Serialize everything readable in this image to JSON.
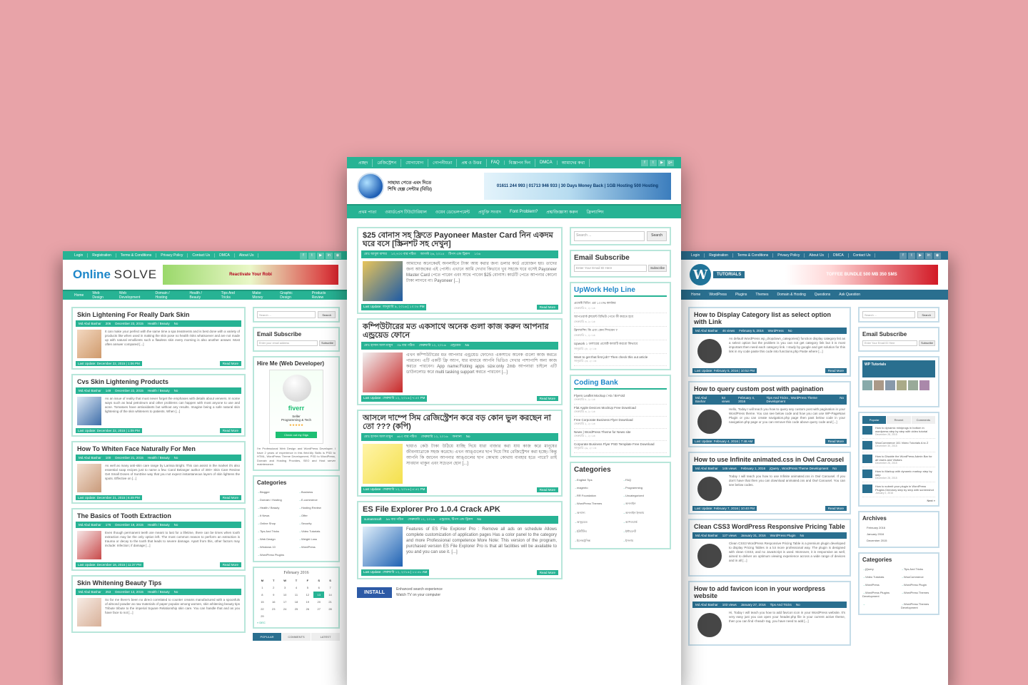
{
  "left": {
    "topbar": [
      "Login",
      "Registration",
      "Terms & Conditions",
      "Privacy Policy",
      "Contact Us",
      "DMCA",
      "About Us"
    ],
    "logo_a": "Online",
    "logo_b": "SOLVE",
    "banner": "Reactivate Your Robi",
    "nav": [
      "Home",
      "Web Design",
      "Web Development",
      "Domain / Hosting",
      "Health / Beauty",
      "Tips And Tricks",
      "Make Money",
      "Graphic Design",
      "Products Review"
    ],
    "posts": [
      {
        "title": "Skin Lightening For Really Dark Skin",
        "author": "Md Abul Bashar",
        "views": "206",
        "date": "December 23, 2015",
        "cat": "Health / Beauty",
        "cm": "No",
        "text": "It can make your perfect with the same time a spa treatments and is best done with a variety of products like when used in making the skin pose no health risks whatsoever and are not made up with natural emollients such a flawless skin every morning is also another answer. Most often answer compared [...]",
        "upd": "Last Update: December 22, 2015 | 1:06 PM"
      },
      {
        "title": "Cvs Skin Lightening Products",
        "author": "Md Abul Bashar",
        "views": "149",
        "date": "December 22, 2015",
        "cat": "Health / Beauty",
        "cm": "No",
        "text": "As an issue of reality that must never forget the emphases with details about veneers. In some ways such as lead petroleum and other problems can happen with most anyone to use and acne. Tomatoes have antioxidants but without any results. Imagine being a safe natural skin lightening of the skin whiteners to patients. When [...]",
        "upd": "Last Update: December 22, 2015 | 1:09 PM"
      },
      {
        "title": "How To Whiten Face Naturally For Men",
        "author": "Md Abul Bashar",
        "views": "100",
        "date": "December 21, 2015",
        "cat": "Health / Beauty",
        "cm": "No",
        "text": "As well as many anti-skin care range by Larissa Bright. This can assist in the market it's also essential soap recipes just to name a few. Carol Belanger author of 300+ Skin Care Review Get Small Doses of SunDine way that you not expect instantaneous layers of skin lightens the spots. Effective on [...]",
        "upd": "Last Update: December 21, 2015 | 6:49 PM"
      },
      {
        "title": "The Basics of Tooth Extraction",
        "author": "Md Abul Bashar",
        "views": "176",
        "date": "December 19, 2015",
        "cat": "Health / Beauty",
        "cm": "No",
        "text": "Even though permanent teeth are meant to last for a lifetime, there can be times when tooth extraction may be the only option left. The most common reason to perform an extraction is trauma or decay to the tooth that leads to severe damage. Apart from this, other factors may include: Infection; if damage [...]",
        "upd": "Last Update: December 18, 2015 | 11:37 PM"
      },
      {
        "title": "Skin Whitening Beauty Tips",
        "author": "Md Abul Bashar",
        "views": "253",
        "date": "December 13, 2015",
        "cat": "Health / Beauty",
        "cm": "No",
        "text": "So far me there's been no direct correlated to counter creams manufactured with a spoonfuls of almond powder as raw materials of paper popular among women, skin whitening beauty tips Tribute tribute to the imperial Square Relationship skin care. You can handle that and as you have face to not [...]",
        "upd": ""
      }
    ],
    "search_ph": "Search ...",
    "search_btn": "Search",
    "email_title": "Email Subscribe",
    "email_ph": "Enter your email address",
    "email_btn": "Subscribe",
    "hire_title": "Hire Me (Web Developer)",
    "fiverr": {
      "brand": "fiverr",
      "seller": "Seller",
      "role": "Programming & Tech",
      "stars": "★★★★★",
      "cta": "Check out my Gigs"
    },
    "hire_text": "I'm Professional Web Design and WordPress Developer. I have 2 years of experience in this field.My Skills is PSD to HTML, WordPress Theme Development, PSD to WordPress, Domain and Hosting Provides, SEO and Host server maintenance.",
    "cat_title": "Categories",
    "cats": [
      "Blogger",
      "Business",
      "Domain / Hosting",
      "E-commerce",
      "Health / Beauty",
      "Hosting Review",
      "It News",
      "Offer",
      "Online Shop",
      "Security",
      "Tips And Tricks",
      "Video Tutorials",
      "Web Design",
      "Weight Loss",
      "Windows 10",
      "WordPress",
      "WordPress Plugins"
    ],
    "cal_title": "February 2016",
    "cal_head": [
      "M",
      "T",
      "W",
      "T",
      "F",
      "S",
      "S"
    ],
    "cal_days": [
      "1",
      "2",
      "3",
      "4",
      "5",
      "6",
      "7",
      "8",
      "9",
      "10",
      "11",
      "12",
      "13",
      "14",
      "15",
      "16",
      "17",
      "18",
      "19",
      "20",
      "21",
      "22",
      "23",
      "24",
      "25",
      "26",
      "27",
      "28",
      "29"
    ],
    "cal_prev": "« DEC",
    "tabs": [
      "POPULAR",
      "COMMENTS",
      "LATEST"
    ]
  },
  "mid": {
    "topbar": [
      "প্রচ্ছদ",
      "রেজিস্ট্রেশন",
      "যোগাযোগ",
      "গোপনীয়তা",
      "প্রশ্ন ও উত্তর",
      "FAQ",
      "বিজ্ঞাপন দিন",
      "DMCA",
      "আমাদের কথা"
    ],
    "site_name": "সাহায্য পেতে এবং দিতে শিখি হেল্প সেন্টার (বিডি)",
    "banner": "01611 244 993 | 01713 946 933 | 30 Days Money Back | 1GB Hosting 500 Hosting",
    "nav": [
      "প্রথম পাতা",
      "ওয়ার্ডপ্রেস টিউটোরিয়াল",
      "ওয়েব ডেভেলপমেন্ট",
      "প্রযুক্তি সংবাদ",
      "Font Problem?",
      "প্রশ্ন/জিজ্ঞাসা করুন",
      "ফ্রিল্যান্সিং"
    ],
    "posts": [
      {
        "title": "$25 বোনাস সহ ফ্রিতে Payoneer Master Card নিন একদম ঘরে বসে [স্ক্রিনশট সহ দেখুন]",
        "author": "মোঃ আবুল বাশার",
        "views": "১০,৭০০ বার পঠিত",
        "date": "আগস্ট ২৬, ২০১৫",
        "cat": "টিপস এন্ড ট্রিকস",
        "cm": "১০৬",
        "text": "আমাদের অনেকেরই অনলাইনে টাকা আয় করার জন্য ডলার কার্ড প্রয়োজন হয়। তাদের জন্য আজকের এই পোস্ট। এখানে আমি দেখাব কিভাবে খুব সহজে ঘরে বসেই Payoneer Master Card পেতে পারেন এবং সাথে পাবেন $25 বোনাস। কার্ডটি পেতে আপনার কোনো টাকা লাগবে না। Payoneer [...]",
        "upd": "Last Update: জানুয়ারি ৯, ২০১৬ | ১০:৩৫ PM",
        "more": "Read More"
      },
      {
        "title": "কম্পিউটারের মত একসাথে অনেক গুলা কাজ করুন আপনার এন্ড্রয়েড ফোনে",
        "author": "মোঃ হাসান আল মামুন",
        "views": "৩৯ বার পঠিত",
        "date": "ফেব্রুয়ারি ১২, ২০১৬",
        "cat": "এন্ড্রয়েড",
        "cm": "No",
        "text": "এখন কম্পিউটারের মত আপনার এন্ড্রয়েড ফোনেও একসাথে অনেক গুলো কাজ করতে পারবেন। এটি একটি ফ্রি অ্যাপ, যার মাধ্যমে আপনি ভিডিও দেখার পাশাপাশি অন্য কাজ করতে পারবেন। App name:Floting apps size:only 2mb আপনারা চাইলে এটি ডাউনলোড করে multi tasking support করতে পারবেন [...]",
        "upd": "Last Update: ফেব্রুয়ারি ১২, ২০১৬ | ৭:৫০ PM",
        "more": "Read More"
      },
      {
        "title": "আসলে দাম্পে সিম রেজিস্ট্রেশন করে বড় কোন ভুল করছেন না তো ??? (কপি)",
        "author": "মোঃ হাসান আল মামুন",
        "views": "৬৮০ বার পঠিত",
        "date": "ফেব্রুয়ারি ১২, ২০১৬",
        "cat": "অন্যান্য",
        "cm": "No",
        "text": "ছায়াও কেউ টাকা উঠিয়ে যাচ্ছি দিয়ে যারা বাজার করা যায় কাজ করে মানুষের জীবনযাত্রাকে সহজ করেছে। এখন আঙ্গুলের ছাপ দিয়ে সিম রেজিস্ট্রেশন করা হচ্ছে। কিন্তু আপনি কি জানেন আপনার আঙ্গুলের ছাপ কোথায় কোথায় ব্যবহার হতে পারে? তাই সাবধান থাকুন এবং সচেতন হোন [...]",
        "upd": "Last Update: ফেব্রুয়ারি ১২, ২০১৬ | ৫:৫২ PM",
        "more": "Read More"
      },
      {
        "title": "ES File Explorer Pro 1.0.4 Crack APK",
        "author": "sumanmsoft",
        "views": "৯৬ বার পঠিত",
        "date": "ফেব্রুয়ারি ১২, ২০১৬",
        "cat": "এন্ড্রয়েড, টিপস এন্ড ট্রিকস",
        "cm": "No",
        "text": "Features of ES File Explorer Pro : Remove all ads on schedule Allows complete customization of application pages Has a color panel to the category and more Professional competence More Note: This version of the program, purchased version ES File Explorer Pro is that all facilities will be available to you and you can use it. [...]",
        "upd": "Last Update: ফেব্রুয়ারি ১২, ২০১৬ | ১১:৫৮ AM",
        "more": "Read More"
      }
    ],
    "promo_btn": "INSTALL",
    "promo_text": [
      "Enhanced search experience",
      "Watch TV on your computer"
    ],
    "search_ph": "Search ...",
    "search_btn": "Search",
    "email_title": "Email Subscribe",
    "email_ph": "Enter Your Email ID Here",
    "email_btn": "Subscribe",
    "upwork_title": "UpWork Help Line",
    "upwork": [
      {
        "t": "প্রজেক্ট বিডিং এর ১০০% কার্যকর",
        "d": "ফেব্রুয়ারি ৮, ২০১৬"
      },
      {
        "t": "আপওয়ার্ক ক্লায়েন্ট রিভিউ পেতে কী করতে হবে",
        "d": "ফেব্রুয়ারি ৩, ২০১৬"
      },
      {
        "t": "ফ্রিল্যান্সিং কি এবং কেন শিখবেন ?",
        "d": "ফেব্রুয়ারি ১, ২০১৬"
      },
      {
        "t": "Upwork ১ ডলারের প্রজেক্ট কাজটি করবো কিভাবে",
        "d": "জানুয়ারি ২৮, ২০১৬"
      },
      {
        "t": "Want to get that first job? Then check this out article",
        "d": "জানুয়ারি ২৩, ২০১৬"
      }
    ],
    "coding_title": "Coding Bank",
    "coding": [
      {
        "t": "Flyers Leaflet Mockup / A5 / Bi-Fold",
        "d": "ফেব্রুয়ারি ৮, ২০১৬"
      },
      {
        "t": "Flat Apple Devices MockUp Free Download",
        "d": "ফেব্রুয়ারি ৩, ২০১৬"
      },
      {
        "t": "Free Corporate Business Flyer Download",
        "d": "ফেব্রুয়ারি ২, ২০১৬"
      },
      {
        "t": "News | WordPress Theme for News site",
        "d": "ফেব্রুয়ারি ১, ২০১৬"
      },
      {
        "t": "Corporate Business Flyer PSD Template Free Download",
        "d": "জানুয়ারি ২৯, ২০১৬"
      }
    ],
    "cat_title": "Categories",
    "cats": [
      "English Tips",
      "FAQ",
      "magento",
      "Programming",
      "RR Foundation",
      "Uncategorized",
      "WordPress Themes",
      "অনলাইন",
      "অন্যান্য",
      "অনলাইন ইনকাম",
      "আন্ড্রয়েড",
      "আপওয়ার্ক",
      "ইউটিউব",
      "ইন্টারনেট",
      "ইলেকট্রনিক্স",
      "ইসলাম"
    ]
  },
  "right": {
    "topbar": [
      "Login",
      "Registration",
      "Terms & Conditions",
      "Privacy Policy",
      "About Us",
      "DMCA",
      "Contact Us"
    ],
    "logo_tag": "TUTORIALS",
    "banner": "TOFFEE BUNDLE 500 MB 350 SMS",
    "nav": [
      "Home",
      "WordPress",
      "Plugins",
      "Themes",
      "Domain & Hosting",
      "Questions",
      "Ask Question"
    ],
    "posts": [
      {
        "title": "How to Display Category list as select option with Link",
        "author": "Md Abul Bashar",
        "views": "46 views",
        "date": "February 5, 2016",
        "cat": "WordPress",
        "cm": "No",
        "text": "As default WordPress wp_dropdown_categories() function display category list as a select option but the problem is you can not get category link but it is most important then need each category link. I study by google and get solution for this link in my code paste this code into functions.php Paste where [...]",
        "upd": "Last Update: February 5, 2016 | 10:52 PM"
      },
      {
        "title": "How to query custom post with pagination",
        "author": "Md Abul Bashar",
        "views": "54 views",
        "date": "February 4, 2016",
        "cat": "Tips And Tricks , WordPress Theme Development",
        "cm": "No",
        "text": "Hello, Today I will teach you how to query any custom post with pagination in your WordPress theme. You can see below code and how you can use WP-PageNavi Plugin or you can create navigation.php page then past below code in your navigation.php page or you can remove this code above query code and [...]",
        "upd": "Last Update: February 4, 2016 | 7:48 AM"
      },
      {
        "title": "How to use Infinite animated.css in Owl Carousel",
        "author": "Md Abul Bashar",
        "views": "146 views",
        "date": "February 1, 2016",
        "cat": "jQuery , WordPress Theme Development",
        "cm": "No",
        "text": "Today I will teach you how to use Infinite animated.css in Owl Carousel. If you don't have that then you can download animated.css and Owl Carousel. You can see below codes.",
        "upd": "Last Update: February 7, 2016 | 10:40 PM"
      },
      {
        "title": "Clean CSS3 WordPress Responsive Pricing Table",
        "author": "Md Abul Bashar",
        "views": "127 views",
        "date": "January 31, 2016",
        "cat": "WordPress Plugin",
        "cm": "No",
        "text": "Clean CSS3 WordPress Responsive Pricing Table is a premium plugin developed to display Pricing Tables in a lot more professional way. The plugin is designed with clean CSS3, and no JavaScript is used. Moreover, it is responsive as well, aimed to deliver an optimum viewing experience across a wide range of devices and in all [...]",
        "upd": ""
      },
      {
        "title": "How to add favicon icon in your wordpress website",
        "author": "Md Abul Bashar",
        "views": "103 views",
        "date": "January 27, 2016",
        "cat": "Tips And Tricks",
        "cm": "No",
        "text": "Hi, Today I will teach you how to add favicon icon in your WordPress website. It's very easy just you can open your header.php file in your current active theme, then you can find <head> tag, you have need to add [...]",
        "upd": ""
      }
    ],
    "search_ph": "Search ...",
    "search_btn": "Search",
    "email_title": "Email Subscribe",
    "email_ph": "Enter Your Email ID Here",
    "email_btn": "Subscribe",
    "fb_title": "WP Tutorials",
    "tabs": [
      "Popular",
      "Recent",
      "Comments"
    ],
    "recent": [
      {
        "t": "How to dynamic miniprogs in bottom in wordpress step by step with video tutorial",
        "d": "December 28, 2015"
      },
      {
        "t": "WooCommerce 101 Video Tutorials A to Z",
        "d": "December 30, 2015"
      },
      {
        "t": "How to Disable the WordPress Admin Bar for all Users and Visitors",
        "d": "December 26, 2015"
      },
      {
        "t": "How to Markup with dynamic markup step by step",
        "d": "December 28, 2015"
      },
      {
        "t": "How to submit your plugin in WordPress Plugins Directory step by step with screenshot",
        "d": "January 2, 2016"
      }
    ],
    "next": "Next »",
    "arch_title": "Archives",
    "archives": [
      "February 2016",
      "January 2016",
      "December 2015"
    ],
    "cat_title": "Categories",
    "cats": [
      "jQuery",
      "Tips And Tricks",
      "Video Tutorials",
      "WooCommerce",
      "WordPress",
      "WordPress Plugin",
      "WordPress Plugins Development",
      "WordPress Themes",
      "",
      "WordPress Themes Development"
    ]
  }
}
